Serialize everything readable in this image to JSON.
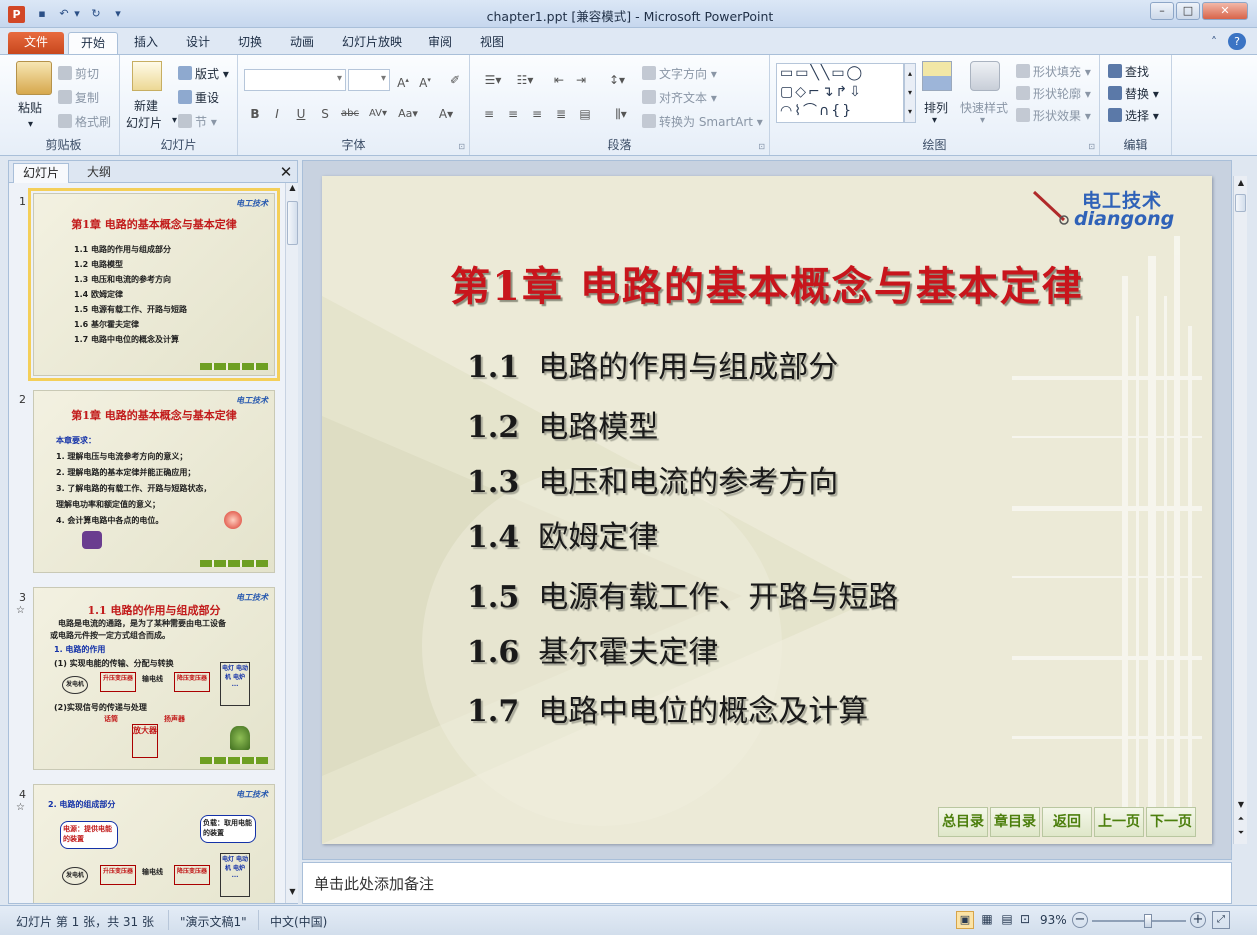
{
  "window": {
    "title": "chapter1.ppt [兼容模式] - Microsoft PowerPoint",
    "app_icon": "P"
  },
  "tabs": [
    "文件",
    "开始",
    "插入",
    "设计",
    "切换",
    "动画",
    "幻灯片放映",
    "审阅",
    "视图"
  ],
  "ribbon": {
    "clipboard": {
      "label": "剪贴板",
      "paste": "粘贴",
      "cut": "剪切",
      "copy": "复制",
      "format_painter": "格式刷"
    },
    "slides": {
      "label": "幻灯片",
      "new_slide_1": "新建",
      "new_slide_2": "幻灯片",
      "layout": "版式",
      "reset": "重设",
      "section": "节"
    },
    "font": {
      "label": "字体"
    },
    "paragraph": {
      "label": "段落",
      "text_direction": "文字方向",
      "align_text": "对齐文本",
      "smartart": "转换为 SmartArt"
    },
    "drawing": {
      "label": "绘图",
      "arrange": "排列",
      "quick_styles": "快速样式",
      "shape_fill": "形状填充",
      "shape_outline": "形状轮廓",
      "shape_effects": "形状效果"
    },
    "editing": {
      "label": "编辑",
      "find": "查找",
      "replace": "替换",
      "select": "选择"
    }
  },
  "left_panel": {
    "tab_slides": "幻灯片",
    "tab_outline": "大纲"
  },
  "thumbs": {
    "t1": {
      "num": "1",
      "logo": "电工技术",
      "title": "第1章  电路的基本概念与基本定律",
      "lines": [
        "1.1  电路的作用与组成部分",
        "1.2  电路模型",
        "1.3  电压和电流的参考方向",
        "1.4  欧姆定律",
        "1.5  电源有载工作、开路与短路",
        "1.6  基尔霍夫定律",
        "1.7  电路中电位的概念及计算"
      ]
    },
    "t2": {
      "num": "2",
      "logo": "电工技术",
      "title": "第1章  电路的基本概念与基本定律",
      "heading": "本章要求：",
      "lines": [
        "1. 理解电压与电流参考方向的意义；",
        "2. 理解电路的基本定律并能正确应用；",
        "3. 了解电路的有载工作、开路与短路状态，",
        "   理解电功率和额定值的意义；",
        "4. 会计算电路中各点的电位。"
      ]
    },
    "t3": {
      "num": "3",
      "star": "☆",
      "logo": "电工技术",
      "title": "1.1   电路的作用与组成部分",
      "lines": [
        "电路是电流的通路，是为了某种需要由电工设备",
        "或电路元件按一定方式组合而成。",
        "1. 电路的作用",
        "(1) 实现电能的传输、分配与转换",
        "(2)实现信号的传递与处理"
      ],
      "diagram": {
        "gen": "发电机",
        "up": "升压变压器",
        "line": "输电线",
        "down": "降压变压器",
        "load": "电灯 电动机 电炉 ...",
        "mic": "话筒",
        "amp": "放大器",
        "speaker": "扬声器"
      }
    },
    "t4": {
      "num": "4",
      "star": "☆",
      "logo": "电工技术",
      "title": "2. 电路的组成部分",
      "power": "电源：提供电能的装置",
      "load_note": "负载：取用电能的装置",
      "diagram": {
        "gen": "发电机",
        "up": "升压变压器",
        "line": "输电线",
        "down": "降压变压器",
        "load": "电灯 电动机 电炉 ..."
      }
    }
  },
  "slide": {
    "logo_cn": "电工技术",
    "logo_en": "diangong",
    "title": "第1章  电路的基本概念与基本定律",
    "items": [
      {
        "num": "1.1",
        "text": "电路的作用与组成部分"
      },
      {
        "num": "1.2",
        "text": "电路模型"
      },
      {
        "num": "1.3",
        "text": "电压和电流的参考方向"
      },
      {
        "num": "1.4",
        "text": "欧姆定律"
      },
      {
        "num": "1.5",
        "text": "电源有载工作、开路与短路"
      },
      {
        "num": "1.6",
        "text": "基尔霍夫定律"
      },
      {
        "num": "1.7",
        "text": "电路中电位的概念及计算"
      }
    ],
    "nav": [
      "总目录",
      "章目录",
      "返回",
      "上一页",
      "下一页"
    ]
  },
  "notes": {
    "placeholder": "单击此处添加备注"
  },
  "status": {
    "slide_info": "幻灯片 第 1 张，共 31 张",
    "theme": "\"演示文稿1\"",
    "language": "中文(中国)",
    "zoom": "93%",
    "zoom_level": 0.6
  }
}
